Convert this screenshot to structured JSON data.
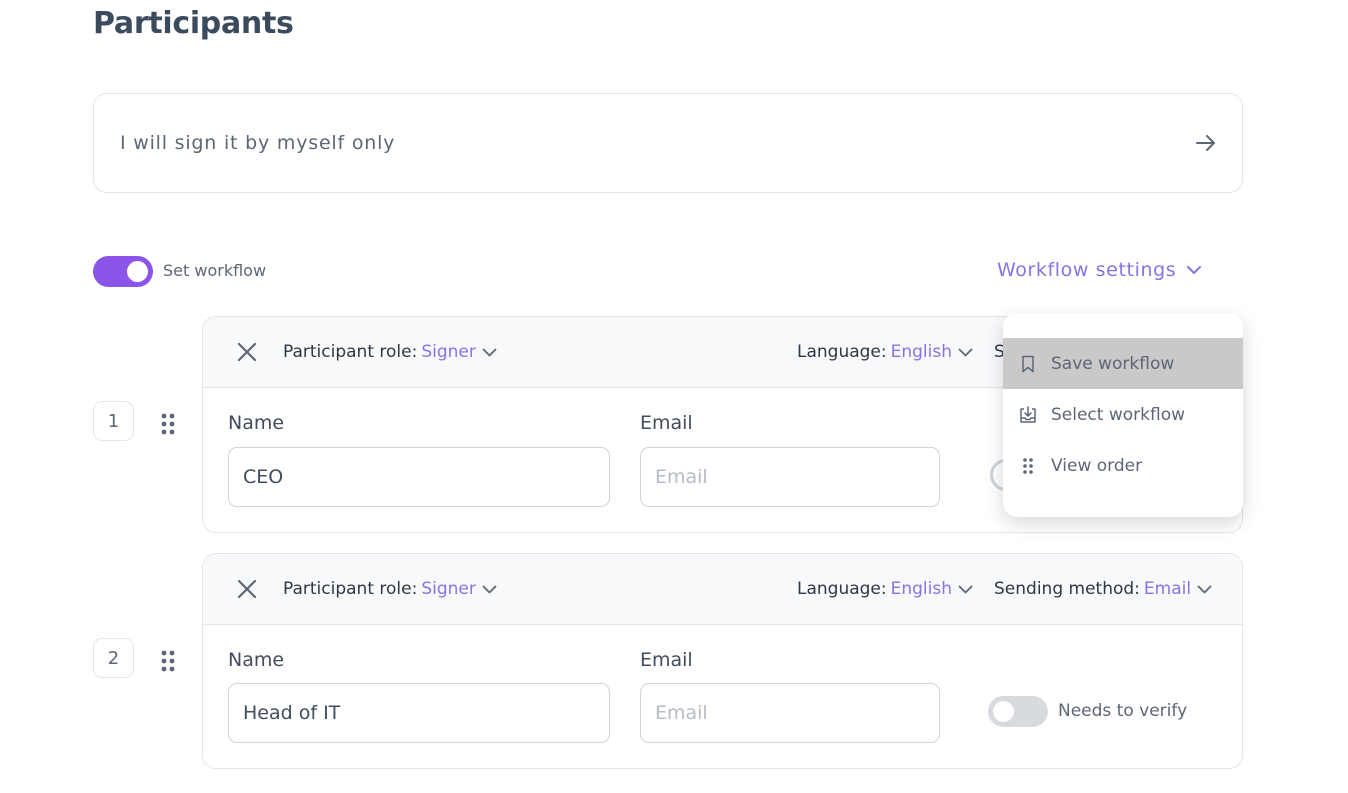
{
  "page": {
    "title": "Participants"
  },
  "self_sign": {
    "label": "I will sign it by myself only"
  },
  "workflow": {
    "toggle_label": "Set workflow",
    "toggle_on": true,
    "settings_label": "Workflow settings"
  },
  "dropdown": {
    "items": [
      {
        "label": "Save workflow",
        "icon": "bookmark-icon",
        "highlighted": true
      },
      {
        "label": "Select workflow",
        "icon": "select-workflow-icon",
        "highlighted": false
      },
      {
        "label": "View order",
        "icon": "drag-dots-icon",
        "highlighted": false
      }
    ]
  },
  "participants": [
    {
      "number": "1",
      "role_label": "Participant role:",
      "role_value": "Signer",
      "language_label": "Language:",
      "language_value": "English",
      "sending_label_partial": "S",
      "name_label": "Name",
      "name_value": "CEO",
      "email_label": "Email",
      "email_placeholder": "Email"
    },
    {
      "number": "2",
      "role_label": "Participant role:",
      "role_value": "Signer",
      "language_label": "Language:",
      "language_value": "English",
      "sending_label": "Sending method:",
      "sending_value": "Email",
      "name_label": "Name",
      "name_value": "Head of IT",
      "email_label": "Email",
      "email_placeholder": "Email",
      "verify_label": "Needs to verify",
      "verify_on": false
    }
  ],
  "colors": {
    "accent": "#8a55e8",
    "link": "#8a72e6",
    "highlight": "#c9c9c9"
  }
}
